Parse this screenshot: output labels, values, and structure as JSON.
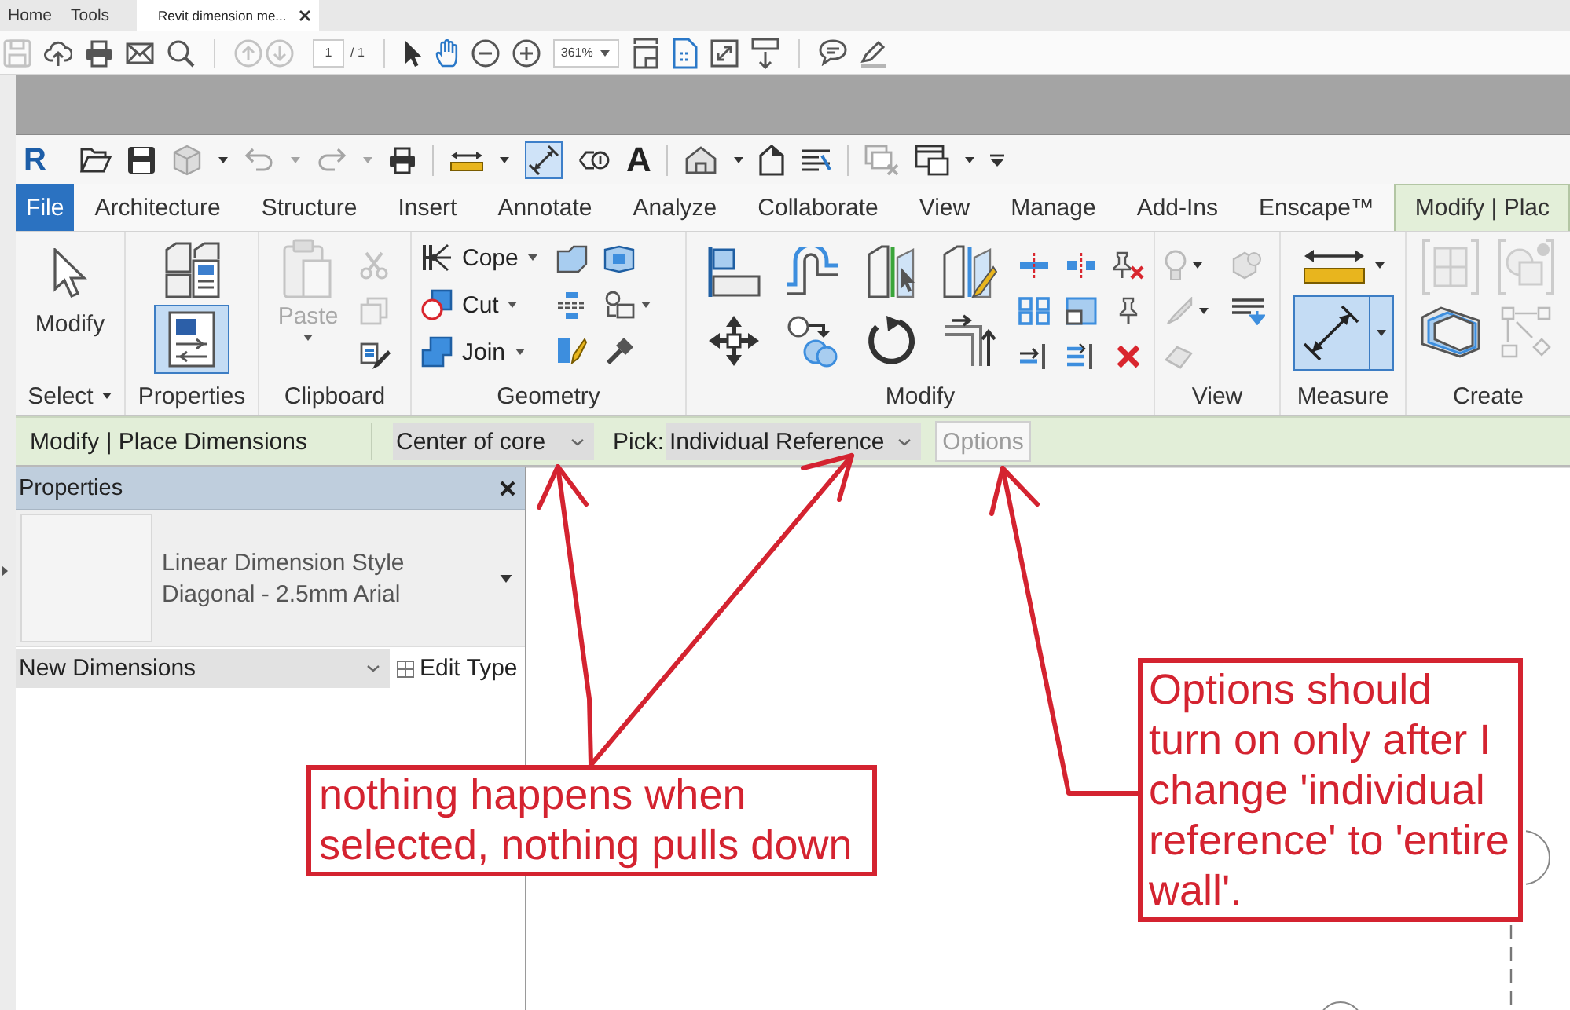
{
  "acrobat": {
    "tabs": [
      {
        "label": "Home",
        "kind": "menu",
        "selected": false
      },
      {
        "label": "Tools",
        "kind": "menu",
        "selected": false
      },
      {
        "label": "Revit dimension me...",
        "kind": "document",
        "selected": true
      }
    ],
    "toolbar": {
      "save_disabled": true,
      "page_nav_disabled": true,
      "page": "1",
      "page_total": "/ 1",
      "hand_tool_selected": true,
      "zoom": "361%"
    }
  },
  "revit": {
    "quick_access": {
      "logo": "R",
      "dimension_tool_active": true,
      "text_button": "A"
    },
    "ribbon_tabs": [
      {
        "label": "File",
        "kind": "file",
        "selected": false
      },
      {
        "label": "Architecture",
        "kind": "tab",
        "selected": false
      },
      {
        "label": "Structure",
        "kind": "tab",
        "selected": false
      },
      {
        "label": "Insert",
        "kind": "tab",
        "selected": false
      },
      {
        "label": "Annotate",
        "kind": "tab",
        "selected": false
      },
      {
        "label": "Analyze",
        "kind": "tab",
        "selected": false
      },
      {
        "label": "Collaborate",
        "kind": "tab",
        "selected": false
      },
      {
        "label": "View",
        "kind": "tab",
        "selected": false
      },
      {
        "label": "Manage",
        "kind": "tab",
        "selected": false
      },
      {
        "label": "Add-Ins",
        "kind": "tab",
        "selected": false
      },
      {
        "label": "Enscape™",
        "kind": "tab",
        "selected": false
      },
      {
        "label": "Modify | Plac",
        "kind": "contextual",
        "selected": true
      }
    ],
    "panels": [
      {
        "kind": "select",
        "title": "Select",
        "menu": true,
        "label": "Modify"
      },
      {
        "kind": "properties",
        "title": "Properties",
        "buttons": [
          {
            "selected": false
          },
          {
            "selected": true
          }
        ]
      },
      {
        "kind": "clipboard",
        "title": "Clipboard",
        "paste": {
          "label": "Paste",
          "disabled": true
        }
      },
      {
        "kind": "geometry",
        "title": "Geometry",
        "buttons": [
          {
            "label": "Cope"
          },
          {
            "label": "Cut"
          },
          {
            "label": "Join"
          }
        ]
      },
      {
        "kind": "modify",
        "title": "Modify"
      },
      {
        "kind": "view",
        "title": "View"
      },
      {
        "kind": "measure",
        "title": "Measure",
        "buttons": [
          {
            "selected": false
          },
          {
            "selected": true
          }
        ]
      },
      {
        "kind": "create",
        "title": "Create"
      }
    ],
    "options_bar": {
      "context": "Modify | Place Dimensions",
      "location_line": "Center of core",
      "pick_label": "Pick:",
      "pick": "Individual Reference",
      "options": {
        "label": "Options",
        "disabled": true
      }
    },
    "properties": {
      "title": "Properties",
      "type_family": "Linear Dimension Style",
      "type_name": "Diagonal - 2.5mm Arial",
      "filter": "New Dimensions",
      "edit_type": "Edit Type"
    }
  },
  "annotations": [
    {
      "text": "nothing happens when selected, nothing pulls down"
    },
    {
      "text": "Options should turn on only after I change 'individual reference' to 'entire wall'."
    }
  ]
}
